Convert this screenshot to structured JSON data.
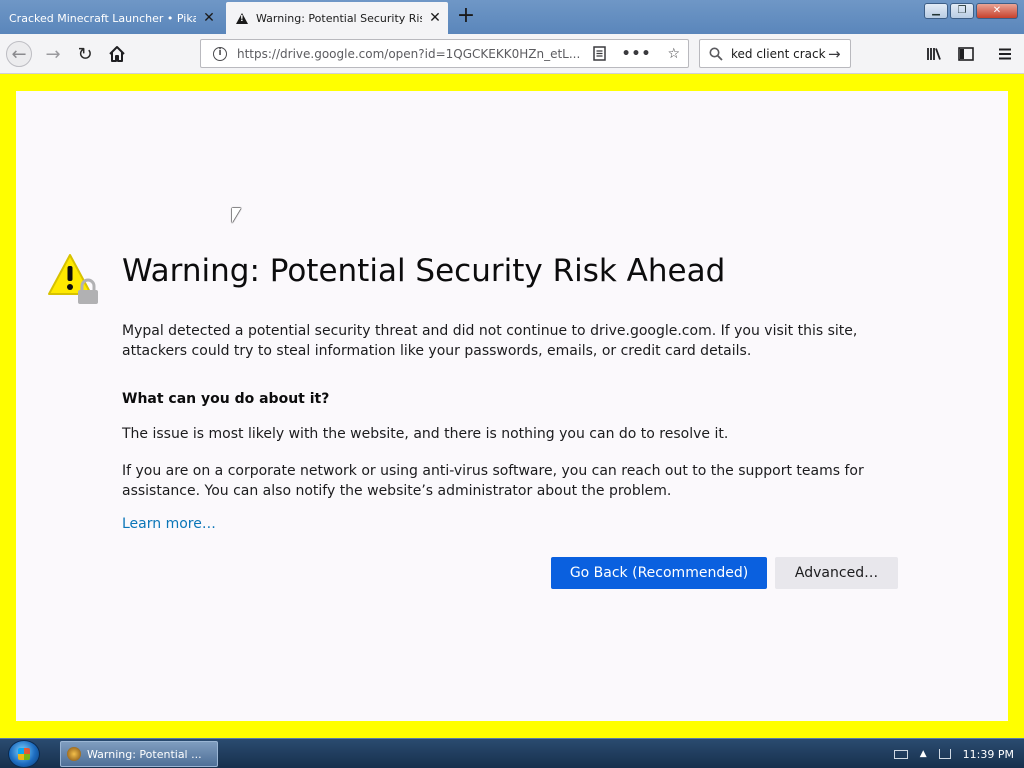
{
  "tabs": [
    {
      "label": "Cracked Minecraft Launcher • Pikade",
      "active": false
    },
    {
      "label": "Warning: Potential Security Risk Ahead",
      "active": true
    }
  ],
  "toolbar": {
    "url": "https://drive.google.com/open?id=1QGCKEKK0HZn_etL...",
    "search_value": "ked client crack"
  },
  "warning": {
    "title": "Warning: Potential Security Risk Ahead",
    "description": "Mypal detected a potential security threat and did not continue to drive.google.com. If you visit this site, attackers could try to steal information like your passwords, emails, or credit card details.",
    "subheading": "What can you do about it?",
    "para1": "The issue is most likely with the website, and there is nothing you can do to resolve it.",
    "para2": "If you are on a corporate network or using anti-virus software, you can reach out to the support teams for assistance. You can also notify the website’s administrator about the problem.",
    "learn_more": "Learn more…",
    "go_back_label": "Go Back (Recommended)",
    "advanced_label": "Advanced…"
  },
  "taskbar": {
    "item_label": "Warning: Potential ...",
    "clock": "11:39 PM"
  },
  "colors": {
    "page_border": "#ffff00",
    "primary_button": "#0a60df",
    "link": "#0b76b8"
  }
}
